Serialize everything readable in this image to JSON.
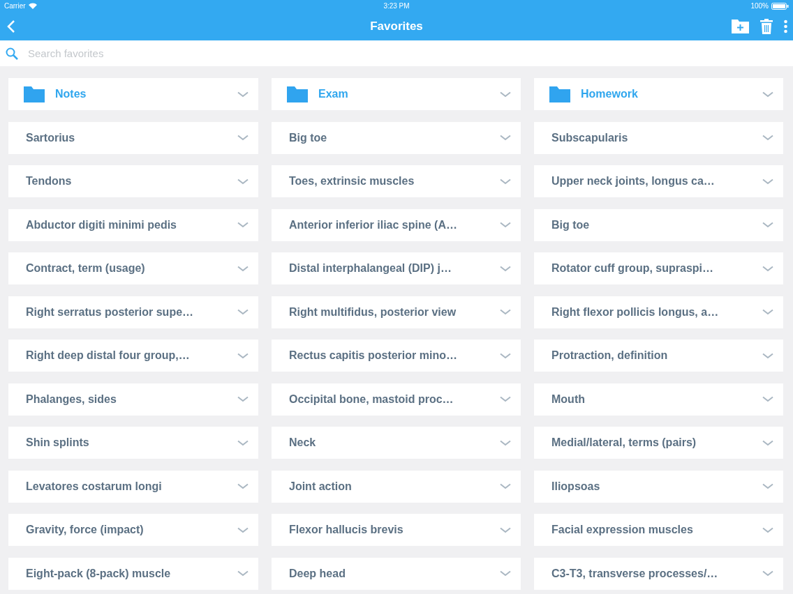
{
  "status_bar": {
    "carrier": "Carrier",
    "time": "3:23 PM",
    "battery": "100%"
  },
  "nav_bar": {
    "title": "Favorites"
  },
  "search": {
    "placeholder": "Search favorites"
  },
  "cards": [
    {
      "kind": "folder",
      "label": "Notes"
    },
    {
      "kind": "folder",
      "label": "Exam"
    },
    {
      "kind": "folder",
      "label": "Homework"
    },
    {
      "kind": "item",
      "label": "Sartorius"
    },
    {
      "kind": "item",
      "label": "Big toe"
    },
    {
      "kind": "item",
      "label": "Subscapularis"
    },
    {
      "kind": "item",
      "label": "Tendons"
    },
    {
      "kind": "item",
      "label": "Toes, extrinsic muscles"
    },
    {
      "kind": "item",
      "label": "Upper neck joints, longus ca…"
    },
    {
      "kind": "item",
      "label": "Abductor digiti minimi pedis"
    },
    {
      "kind": "item",
      "label": "Anterior inferior iliac spine (A…"
    },
    {
      "kind": "item",
      "label": "Big toe"
    },
    {
      "kind": "item",
      "label": "Contract, term (usage)"
    },
    {
      "kind": "item",
      "label": "Distal interphalangeal (DIP) j…"
    },
    {
      "kind": "item",
      "label": "Rotator cuff group, supraspi…"
    },
    {
      "kind": "item",
      "label": "Right serratus posterior supe…"
    },
    {
      "kind": "item",
      "label": "Right multifidus, posterior view"
    },
    {
      "kind": "item",
      "label": "Right flexor pollicis longus, a…"
    },
    {
      "kind": "item",
      "label": "Right deep distal four group,…"
    },
    {
      "kind": "item",
      "label": "Rectus capitis posterior mino…"
    },
    {
      "kind": "item",
      "label": "Protraction, definition"
    },
    {
      "kind": "item",
      "label": "Phalanges, sides"
    },
    {
      "kind": "item",
      "label": "Occipital bone, mastoid proc…"
    },
    {
      "kind": "item",
      "label": "Mouth"
    },
    {
      "kind": "item",
      "label": "Shin splints"
    },
    {
      "kind": "item",
      "label": "Neck"
    },
    {
      "kind": "item",
      "label": "Medial/lateral, terms (pairs)"
    },
    {
      "kind": "item",
      "label": "Levatores costarum longi"
    },
    {
      "kind": "item",
      "label": "Joint action"
    },
    {
      "kind": "item",
      "label": "Iliopsoas"
    },
    {
      "kind": "item",
      "label": "Gravity, force (impact)"
    },
    {
      "kind": "item",
      "label": "Flexor hallucis brevis"
    },
    {
      "kind": "item",
      "label": "Facial expression muscles"
    },
    {
      "kind": "item",
      "label": "Eight-pack (8-pack) muscle"
    },
    {
      "kind": "item",
      "label": "Deep head"
    },
    {
      "kind": "item",
      "label": "C3-T3, transverse processes/…"
    }
  ]
}
